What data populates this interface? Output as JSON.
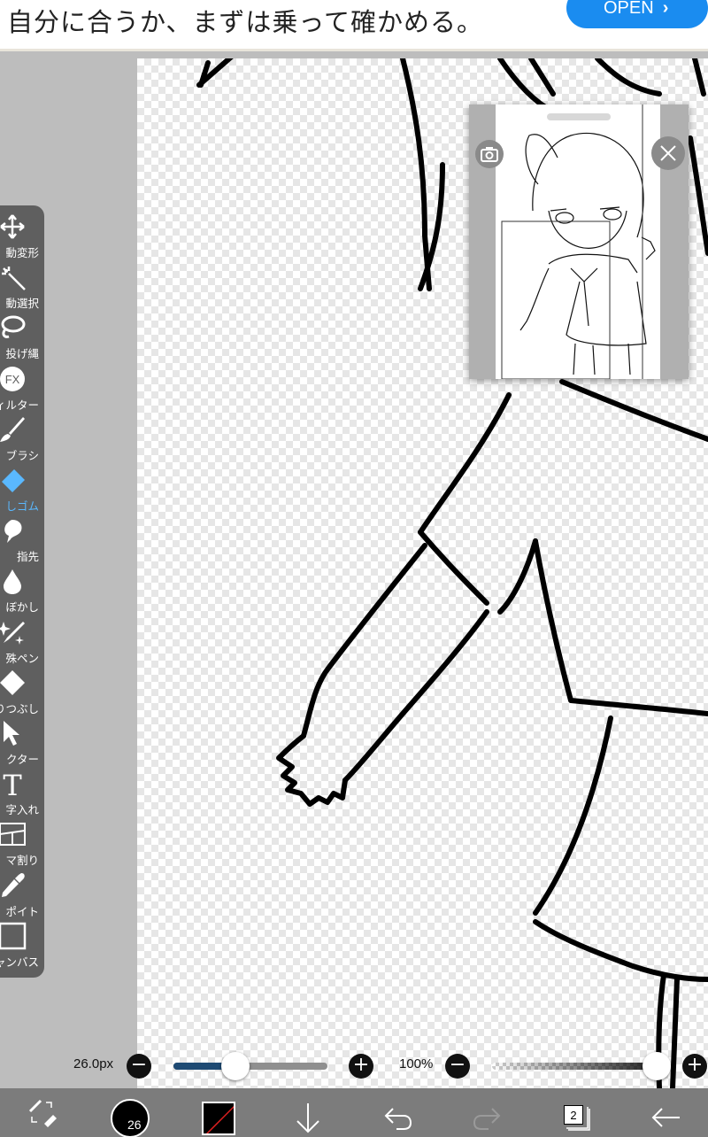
{
  "ad": {
    "text": "自分に合うか、まずは乗って確かめる。",
    "open_label": "OPEN"
  },
  "tools": [
    {
      "label": "動変形",
      "icon": "move-icon",
      "active": false
    },
    {
      "label": "動選択",
      "icon": "magic-wand-icon",
      "active": false
    },
    {
      "label": "投げ縄",
      "icon": "lasso-icon",
      "active": false
    },
    {
      "label": "ィルター",
      "icon": "fx-icon",
      "icon_text": "FX",
      "active": false
    },
    {
      "label": "ブラシ",
      "icon": "brush-icon",
      "active": false
    },
    {
      "label": "しゴム",
      "icon": "eraser-icon",
      "active": true
    },
    {
      "label": "指先",
      "icon": "smudge-icon",
      "active": false
    },
    {
      "label": "ぼかし",
      "icon": "blur-drop-icon",
      "active": false
    },
    {
      "label": "殊ペン",
      "icon": "special-pen-icon",
      "active": false
    },
    {
      "label": "りつぶし",
      "icon": "fill-bucket-icon",
      "active": false
    },
    {
      "label": "クター",
      "icon": "selector-arrow-icon",
      "active": false
    },
    {
      "label": "字入れ",
      "icon": "text-tool-icon",
      "icon_text": "T",
      "active": false
    },
    {
      "label": "マ割り",
      "icon": "frame-divider-icon",
      "active": false
    },
    {
      "label": "ポイト",
      "icon": "eyedropper-icon",
      "active": false
    },
    {
      "label": "ャンバス",
      "icon": "canvas-icon",
      "active": false
    }
  ],
  "brush": {
    "size_label": "26.0px",
    "size_fraction": 0.4,
    "size_badge": "26"
  },
  "opacity": {
    "label": "100%",
    "fraction": 1.0
  },
  "layers": {
    "count": "2"
  },
  "colors": {
    "accent": "#5ab8ff",
    "ad_button": "#1a8cf0",
    "toolbar": "#5f5f5f",
    "bottombar": "#7c7c7c"
  }
}
